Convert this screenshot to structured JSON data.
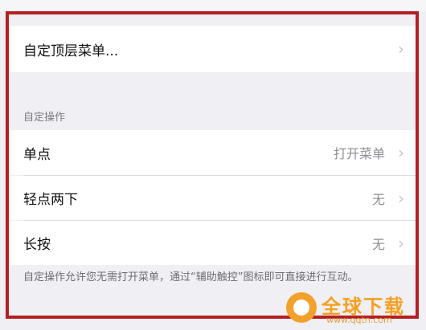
{
  "top_menu": {
    "label": "自定顶层菜单..."
  },
  "section": {
    "header": "自定操作"
  },
  "actions": [
    {
      "label": "单点",
      "value": "打开菜单"
    },
    {
      "label": "轻点两下",
      "value": "无"
    },
    {
      "label": "长按",
      "value": "无"
    }
  ],
  "footer_text": "自定操作允许您无需打开菜单，通过“辅助触控”图标即可直接进行互动。",
  "chevron_glyph": "›",
  "watermark": {
    "text": "全球下载",
    "url": "www.qqtn.com"
  },
  "colors": {
    "highlight_border": "#b51f22",
    "background": "#efeff4",
    "secondary_text": "#8e8e93"
  }
}
